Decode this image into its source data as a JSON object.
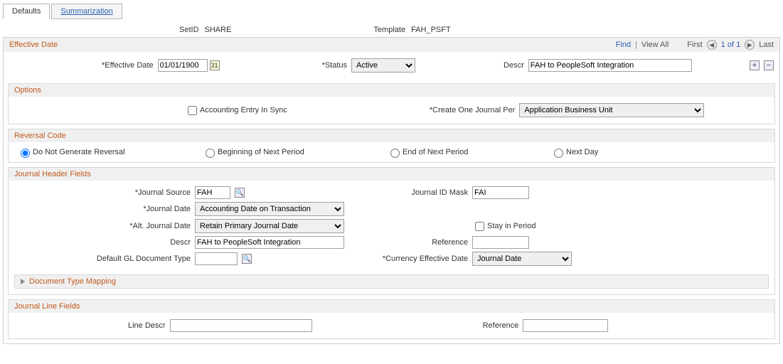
{
  "tabs": {
    "defaults": "Defaults",
    "summarization": "Summarization"
  },
  "header": {
    "setid_label": "SetID",
    "setid_value": "SHARE",
    "template_label": "Template",
    "template_value": "FAH_PSFT"
  },
  "eff": {
    "title": "Effective Date",
    "find": "Find",
    "viewall": "View All",
    "first": "First",
    "pos": "1 of 1",
    "last": "Last",
    "eff_label": "*Effective Date",
    "eff_value": "01/01/1900",
    "status_label": "*Status",
    "status_value": "Active",
    "descr_label": "Descr",
    "descr_value": "FAH to PeopleSoft Integration"
  },
  "options": {
    "title": "Options",
    "sync_label": "Accounting Entry In Sync",
    "cojp_label": "*Create One Journal Per",
    "cojp_value": "Application Business Unit"
  },
  "reversal": {
    "title": "Reversal Code",
    "r1": "Do Not Generate Reversal",
    "r2": "Beginning of Next Period",
    "r3": "End of Next Period",
    "r4": "Next Day"
  },
  "jh": {
    "title": "Journal Header Fields",
    "src_label": "*Journal Source",
    "src_value": "FAH",
    "mask_label": "Journal ID Mask",
    "mask_value": "FAI",
    "jdate_label": "*Journal Date",
    "jdate_value": "Accounting Date on Transaction",
    "altdate_label": "*Alt. Journal Date",
    "altdate_value": "Retain Primary Journal Date",
    "stay_label": "Stay in Period",
    "descr_label": "Descr",
    "descr_value": "FAH to PeopleSoft Integration",
    "ref_label": "Reference",
    "ref_value": "",
    "gl_label": "Default GL Document Type",
    "gl_value": "",
    "ced_label": "*Currency Effective Date",
    "ced_value": "Journal Date",
    "dtm": "Document Type Mapping"
  },
  "jl": {
    "title": "Journal Line Fields",
    "line_label": "Line Descr",
    "line_value": "",
    "ref_label": "Reference",
    "ref_value": ""
  }
}
